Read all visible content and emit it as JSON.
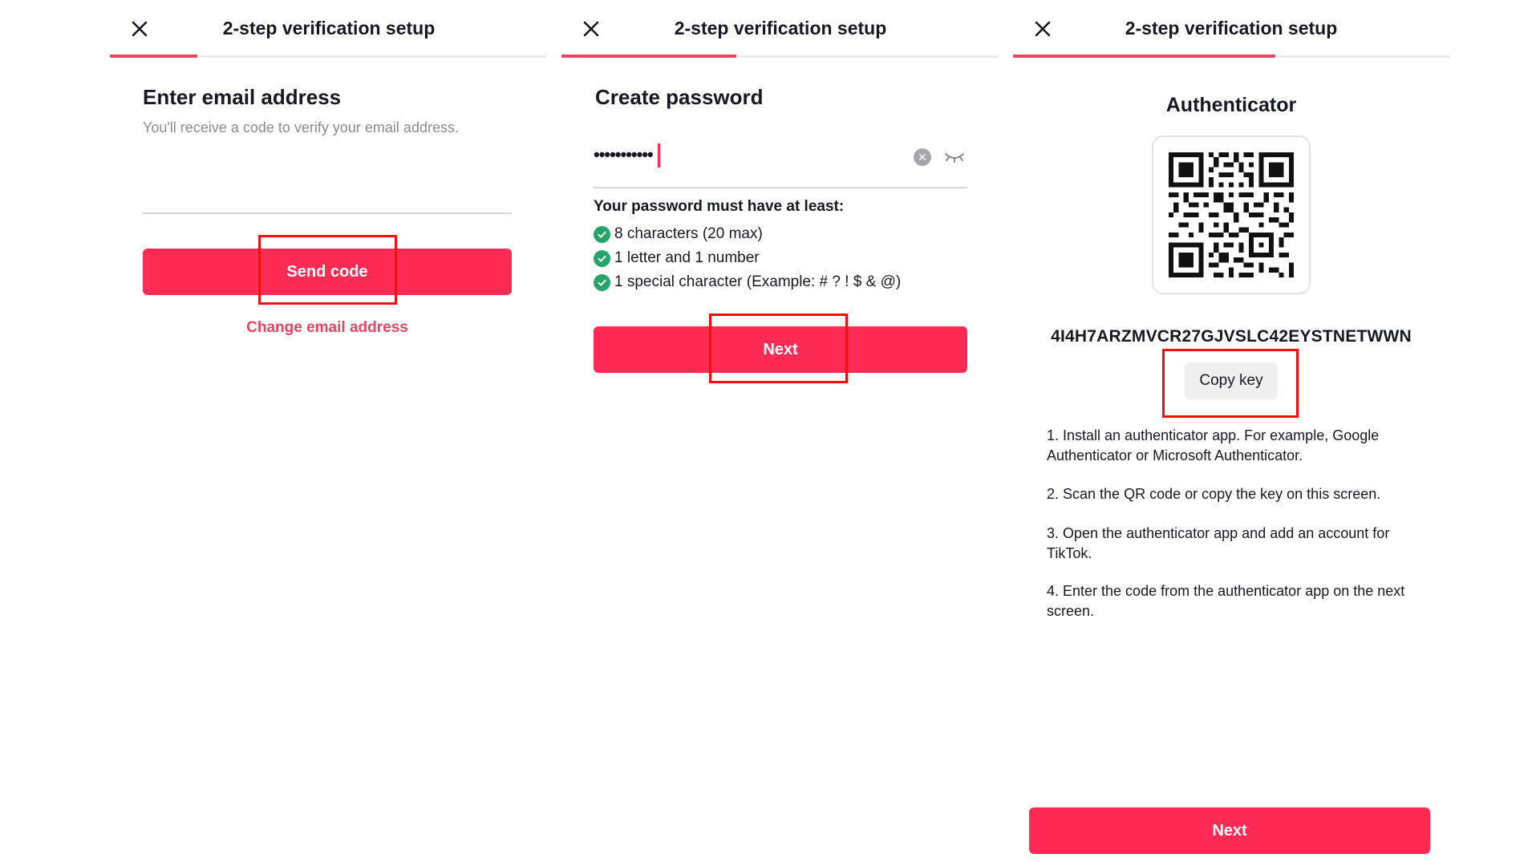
{
  "screen1": {
    "header_title": "2-step verification setup",
    "heading": "Enter email address",
    "subtitle": "You'll receive a code to verify your email address.",
    "email_value": "",
    "email_placeholder": "",
    "send_code_label": "Send code",
    "change_email_label": "Change email address",
    "progress": 0.2
  },
  "screen2": {
    "header_title": "2-step verification setup",
    "heading": "Create password",
    "password_masked": "•••••••••••",
    "requirements_title": "Your password must have at least:",
    "requirements": [
      {
        "text": "8 characters (20 max)",
        "met": true
      },
      {
        "text": "1 letter and 1 number",
        "met": true
      },
      {
        "text": "1 special character (Example: # ? ! $ & @)",
        "met": true
      }
    ],
    "next_label": "Next",
    "progress": 0.4
  },
  "screen3": {
    "header_title": "2-step verification setup",
    "heading": "Authenticator",
    "secret_key": "4I4H7ARZMVCR27GJVSLC42EYSTNETWWN",
    "copy_key_label": "Copy key",
    "steps": [
      "1. Install an authenticator app. For example, Google Authenticator or Microsoft Authenticator.",
      "2. Scan the QR code or copy the key on this screen.",
      "3. Open the authenticator app and add an account for TikTok.",
      "4. Enter the code from the authenticator app on the next screen."
    ],
    "next_label": "Next",
    "progress": 0.6
  },
  "colors": {
    "primary": "#fe2c55",
    "progress": "#e4455f",
    "link": "#e4455f",
    "check": "#25a56a",
    "highlight_box": "#ef1010"
  },
  "icons": [
    "close-icon",
    "clear-input-icon",
    "eye-closed-icon",
    "check-circle-icon",
    "qr-code"
  ]
}
